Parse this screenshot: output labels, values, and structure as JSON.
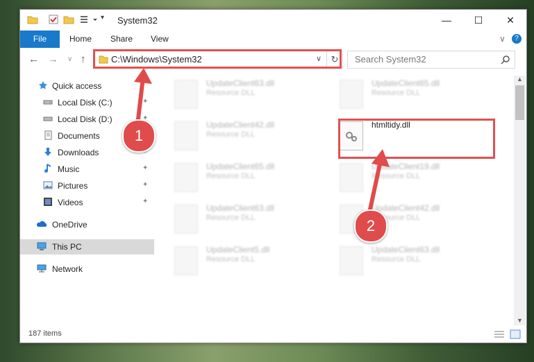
{
  "window": {
    "title": "System32",
    "min_glyph": "—",
    "max_glyph": "☐",
    "close_glyph": "✕"
  },
  "ribbon": {
    "file": "File",
    "home": "Home",
    "share": "Share",
    "view": "View",
    "collapse_glyph": "∨",
    "help_glyph": "?"
  },
  "nav": {
    "back": "←",
    "forward": "→",
    "recent": "∨",
    "up": "↑",
    "address": "C:\\Windows\\System32",
    "address_dropdown": "∨",
    "refresh": "↻",
    "search_placeholder": "Search System32"
  },
  "sidebar": {
    "items": [
      {
        "label": "Quick access",
        "icon": "star-icon",
        "pinned": false
      },
      {
        "label": "Local Disk (C:)",
        "icon": "drive-icon",
        "pinned": true
      },
      {
        "label": "Local Disk (D:)",
        "icon": "drive-icon",
        "pinned": true
      },
      {
        "label": "Documents",
        "icon": "documents-icon",
        "pinned": true
      },
      {
        "label": "Downloads",
        "icon": "downloads-icon",
        "pinned": true
      },
      {
        "label": "Music",
        "icon": "music-icon",
        "pinned": true
      },
      {
        "label": "Pictures",
        "icon": "pictures-icon",
        "pinned": true
      },
      {
        "label": "Videos",
        "icon": "videos-icon",
        "pinned": true
      },
      {
        "label": "OneDrive",
        "icon": "onedrive-icon",
        "pinned": false
      },
      {
        "label": "This PC",
        "icon": "pc-icon",
        "pinned": false,
        "selected": true
      },
      {
        "label": "Network",
        "icon": "network-icon",
        "pinned": false
      }
    ],
    "pin_glyph": "📌"
  },
  "files": {
    "left": [
      {
        "name": "UpdateClient63.dll",
        "type": "Resource DLL"
      },
      {
        "name": "UpdateClient42.dll",
        "type": "Resource DLL"
      },
      {
        "name": "UpdateClient65.dll",
        "type": "Resource DLL"
      },
      {
        "name": "UpdateClient63.dll",
        "type": "Resource DLL"
      },
      {
        "name": "UpdateClient5.dll",
        "type": "Resource DLL"
      }
    ],
    "right": [
      {
        "name": "UpdateClient65.dll",
        "type": "Resource DLL"
      },
      {
        "name": "htmltidy.dll",
        "type": "",
        "highlighted": true
      },
      {
        "name": "UpdateClient19.dll",
        "type": "Resource DLL"
      },
      {
        "name": "UpdateClient42.dll",
        "type": "Resource DLL"
      },
      {
        "name": "UpdateClient63.dll",
        "type": "Resource DLL"
      }
    ]
  },
  "status": {
    "count": "187 items"
  },
  "annotations": {
    "badge1": "1",
    "badge2": "2",
    "color": "#e04b4b"
  }
}
